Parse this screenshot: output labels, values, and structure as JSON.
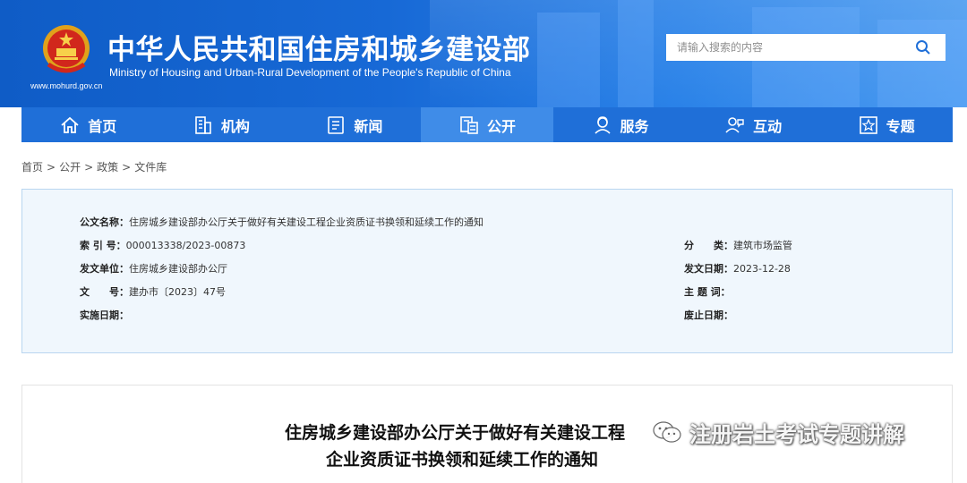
{
  "header": {
    "title_cn": "中华人民共和国住房和城乡建设部",
    "title_en": "Ministry of Housing and Urban-Rural Development of the People's Republic of China",
    "site_url": "www.mohurd.gov.cn",
    "search_placeholder": "请输入搜索的内容"
  },
  "nav": {
    "items": [
      {
        "label": "首页",
        "icon": "home-icon"
      },
      {
        "label": "机构",
        "icon": "building-icon"
      },
      {
        "label": "新闻",
        "icon": "news-icon"
      },
      {
        "label": "公开",
        "icon": "document-icon",
        "active": true
      },
      {
        "label": "服务",
        "icon": "service-icon"
      },
      {
        "label": "互动",
        "icon": "interaction-icon"
      },
      {
        "label": "专题",
        "icon": "topic-icon"
      }
    ]
  },
  "breadcrumb": [
    "首页",
    "公开",
    "政策",
    "文件库"
  ],
  "info": {
    "doc_name_label": "公文名称：",
    "doc_name": "住房城乡建设部办公厅关于做好有关建设工程企业资质证书换领和延续工作的通知",
    "index_label": "索 引 号：",
    "index": "000013338/2023-00873",
    "category_label": "分　　类：",
    "category": "建筑市场监管",
    "issuer_label": "发文单位：",
    "issuer": "住房城乡建设部办公厅",
    "issue_date_label": "发文日期：",
    "issue_date": "2023-12-28",
    "doc_no_label": "文　　号：",
    "doc_no": "建办市〔2023〕47号",
    "subject_label": "主 题 词：",
    "subject": "",
    "effective_label": "实施日期：",
    "effective": "",
    "abolish_label": "废止日期：",
    "abolish": ""
  },
  "article": {
    "title_line1": "住房城乡建设部办公厅关于做好有关建设工程",
    "title_line2": "企业资质证书换领和延续工作的通知"
  },
  "watermark": {
    "text": "注册岩土考试专题讲解"
  }
}
